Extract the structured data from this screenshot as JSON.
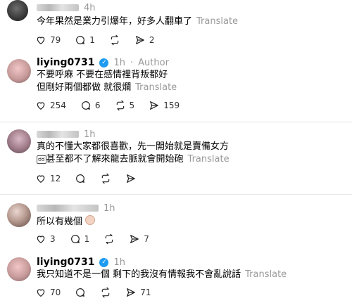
{
  "posts": [
    {
      "time": "4h",
      "text": [
        "今年果然是業力引爆年，好多人翻車了"
      ],
      "translate": "Translate",
      "stats": {
        "likes": "79",
        "comments": "1",
        "reposts": "",
        "shares": "2"
      }
    },
    {
      "username": "liying0731",
      "time": "1h",
      "author_label": "Author",
      "text": [
        "不要呼麻 不要在感情裡背叛都好",
        "但剛好兩個都做 就很爛"
      ],
      "translate": "Translate",
      "stats": {
        "likes": "254",
        "comments": "6",
        "reposts": "5",
        "shares": "159"
      }
    },
    {
      "time": "1h",
      "text": [
        "真的不懂大家都很喜歡，先一開始就是賣備女方",
        "甚至都不了解來龍去脈就會開始砲"
      ],
      "glyph": "ಠಠ",
      "translate": "Translate",
      "stats": {
        "likes": "12",
        "comments": "",
        "reposts": "",
        "shares": ""
      }
    },
    {
      "time": "1h",
      "text": [
        "所以有幾個"
      ],
      "stats": {
        "likes": "3",
        "comments": "1",
        "reposts": "",
        "shares": "7"
      }
    },
    {
      "username": "liying0731",
      "time": "1h",
      "text": [
        "我只知道不是一個 剩下的我沒有情報我不會亂說話"
      ],
      "translate": "Translate",
      "stats": {
        "likes": "70",
        "comments": "",
        "reposts": "",
        "shares": "71"
      }
    }
  ]
}
